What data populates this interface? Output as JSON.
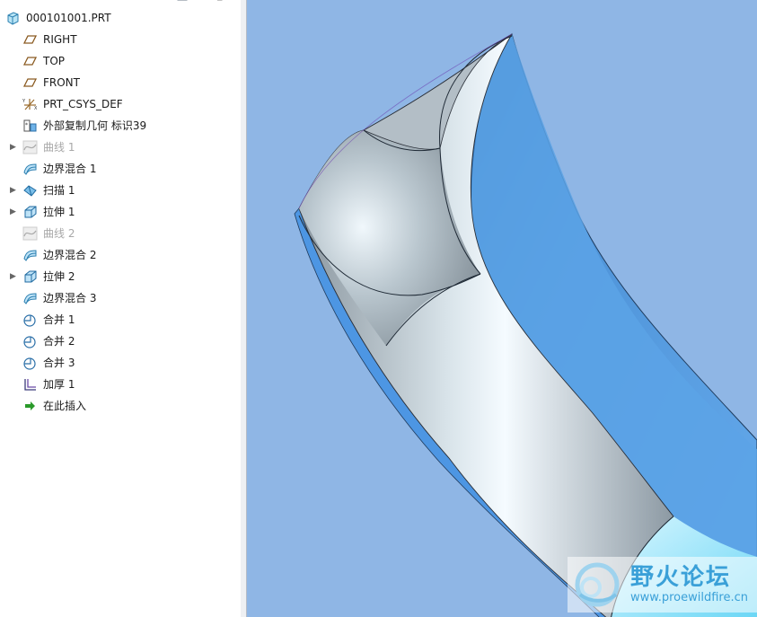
{
  "model_tree": {
    "root": "000101001.PRT",
    "items": [
      {
        "label": "RIGHT",
        "icon": "datum-plane-icon",
        "expandable": false,
        "disabled": false
      },
      {
        "label": "TOP",
        "icon": "datum-plane-icon",
        "expandable": false,
        "disabled": false
      },
      {
        "label": "FRONT",
        "icon": "datum-plane-icon",
        "expandable": false,
        "disabled": false
      },
      {
        "label": "PRT_CSYS_DEF",
        "icon": "csys-icon",
        "expandable": false,
        "disabled": false
      },
      {
        "label": "外部复制几何 标识39",
        "icon": "external-copy-geom-icon",
        "expandable": false,
        "disabled": false
      },
      {
        "label": "曲线 1",
        "icon": "curve-icon",
        "expandable": true,
        "disabled": true
      },
      {
        "label": "边界混合 1",
        "icon": "boundary-blend-icon",
        "expandable": false,
        "disabled": false
      },
      {
        "label": "扫描 1",
        "icon": "sweep-icon",
        "expandable": true,
        "disabled": false
      },
      {
        "label": "拉伸 1",
        "icon": "extrude-icon",
        "expandable": true,
        "disabled": false
      },
      {
        "label": "曲线 2",
        "icon": "curve-icon",
        "expandable": false,
        "disabled": true
      },
      {
        "label": "边界混合 2",
        "icon": "boundary-blend-icon",
        "expandable": false,
        "disabled": false
      },
      {
        "label": "拉伸 2",
        "icon": "extrude-icon",
        "expandable": true,
        "disabled": false
      },
      {
        "label": "边界混合 3",
        "icon": "boundary-blend-icon",
        "expandable": false,
        "disabled": false
      },
      {
        "label": "合并 1",
        "icon": "merge-icon",
        "expandable": false,
        "disabled": false
      },
      {
        "label": "合并 2",
        "icon": "merge-icon",
        "expandable": false,
        "disabled": false
      },
      {
        "label": "合并 3",
        "icon": "merge-icon",
        "expandable": false,
        "disabled": false
      },
      {
        "label": "加厚 1",
        "icon": "thicken-icon",
        "expandable": false,
        "disabled": false
      },
      {
        "label": "在此插入",
        "icon": "insert-here-arrow-icon",
        "expandable": false,
        "disabled": false
      }
    ]
  },
  "viewport": {
    "background": "#8fb6e5",
    "surface_color": "#5ba4e6",
    "shaded_color": "#b8c4cc"
  },
  "watermark": {
    "title": "野火论坛",
    "url": "www.proewildfire.cn"
  }
}
